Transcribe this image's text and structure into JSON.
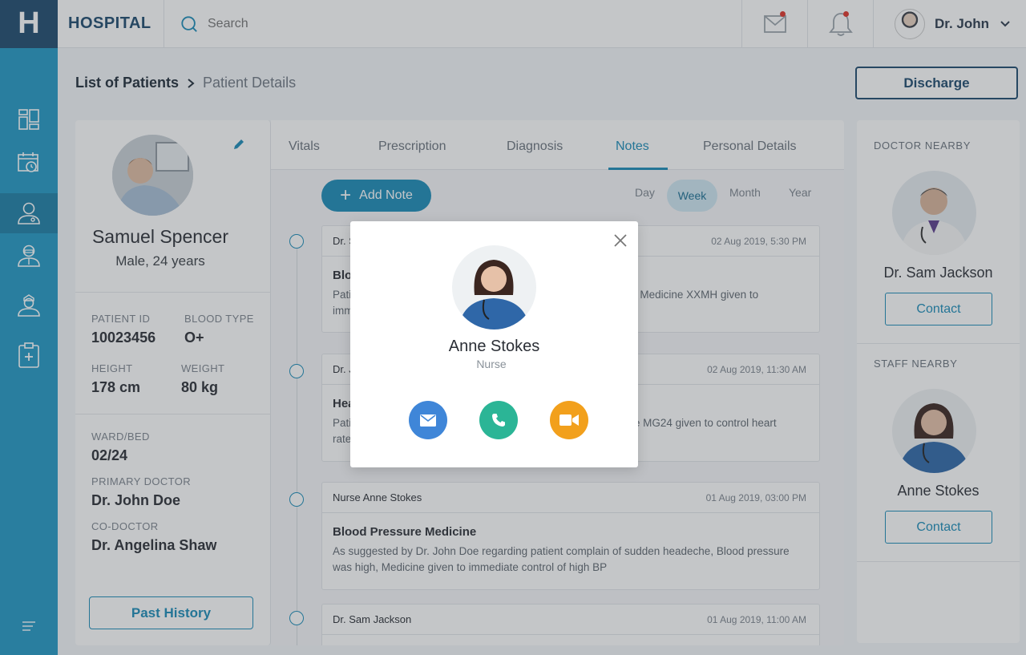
{
  "app": {
    "logo_letter": "H",
    "brand": "HOSPITAL"
  },
  "search": {
    "placeholder": "Search"
  },
  "user": {
    "name": "Dr. John"
  },
  "breadcrumb": {
    "parent": "List of Patients",
    "current": "Patient Details"
  },
  "actions": {
    "discharge": "Discharge"
  },
  "patient": {
    "name": "Samuel Spencer",
    "summary": "Male, 24 years",
    "patient_id_label": "PATIENT ID",
    "patient_id": "10023456",
    "blood_type_label": "BLOOD TYPE",
    "blood_type": "O+",
    "height_label": "HEIGHT",
    "height": "178 cm",
    "weight_label": "WEIGHT",
    "weight": "80 kg",
    "ward_label": "WARD/BED",
    "ward": "02/24",
    "primary_doctor_label": "PRIMARY DOCTOR",
    "primary_doctor": "Dr. John Doe",
    "co_doctor_label": "CO-DOCTOR",
    "co_doctor": "Dr. Angelina Shaw",
    "past_history": "Past History"
  },
  "tabs": [
    "Vitals",
    "Prescription",
    "Diagnosis",
    "Notes",
    "Personal Details"
  ],
  "notes_panel": {
    "add_note": "Add Note",
    "periods": [
      "Day",
      "Week",
      "Month",
      "Year"
    ],
    "notes": [
      {
        "author": "Dr. S",
        "date": "02 Aug 2019, 5:30 PM",
        "title": "Blo",
        "text": "Pati                                                                                              , Medicine XXMH given to\nimm"
      },
      {
        "author": "Dr. J",
        "date": "02 Aug 2019, 11:30 AM",
        "title": "Hea",
        "text": "Pati                                                                                              e MG24 given to control heart\nrate"
      },
      {
        "author": "Nurse Anne Stokes",
        "date": "01 Aug 2019, 03:00 PM",
        "title": "Blood Pressure Medicine",
        "text": "As suggested by Dr. John Doe regarding patient complain of sudden headeche, Blood pressure was high, Medicine given to immediate control of high BP"
      },
      {
        "author": "Dr. Sam Jackson",
        "date": "01 Aug 2019, 11:00 AM",
        "title": "",
        "text": ""
      }
    ]
  },
  "doctor_nearby": {
    "title": "DOCTOR NEARBY",
    "name": "Dr. Sam Jackson",
    "contact": "Contact"
  },
  "staff_nearby": {
    "title": "STAFF NEARBY",
    "name": "Anne Stokes",
    "contact": "Contact"
  },
  "modal": {
    "name": "Anne Stokes",
    "role": "Nurse"
  },
  "colors": {
    "primary": "#1a8bb8",
    "sidebar": "#2298c4",
    "navy": "#1d4a6e",
    "email": "#3f86d8",
    "phone": "#2bb596",
    "video": "#f2a01c",
    "notify_dot": "#e0342a"
  }
}
